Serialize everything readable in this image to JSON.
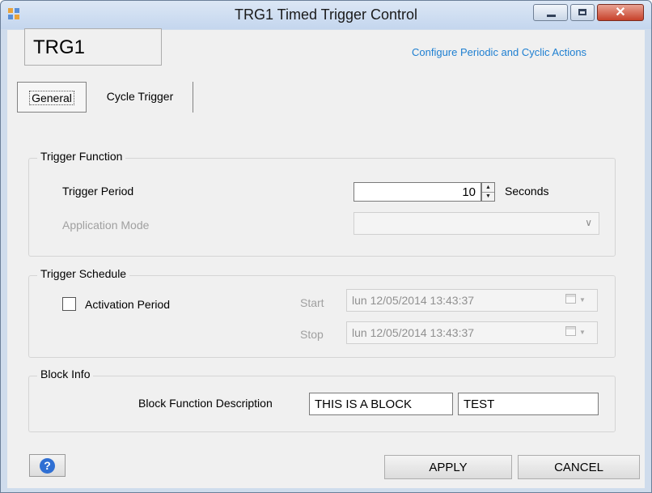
{
  "window": {
    "title": "TRG1 Timed Trigger Control",
    "close_glyph": "✕",
    "minimize_icon": "minimize-icon",
    "maximize_icon": "maximize-icon"
  },
  "header": {
    "block_name": "TRG1",
    "link_text": "Configure Periodic and Cyclic Actions",
    "link_color": "#1e7fd1"
  },
  "tabs": [
    {
      "label": "General",
      "selected": true
    },
    {
      "label": "Cycle Trigger",
      "selected": false
    }
  ],
  "trigger_function": {
    "title": "Trigger Function",
    "trigger_period_label": "Trigger Period",
    "trigger_period_value": "10",
    "trigger_period_unit": "Seconds",
    "application_mode_label": "Application Mode",
    "application_mode_value": ""
  },
  "trigger_schedule": {
    "title": "Trigger Schedule",
    "activation_label": "Activation Period",
    "activation_checked": false,
    "start_label": "Start",
    "start_value": "lun  12/05/2014 13:43:37",
    "stop_label": "Stop",
    "stop_value": "lun  12/05/2014 13:43:37"
  },
  "block_info": {
    "title": "Block Info",
    "description_label": "Block Function Description",
    "description_value": "THIS IS A BLOCK",
    "extra_value": "TEST"
  },
  "footer": {
    "help_glyph": "?",
    "apply_label": "APPLY",
    "cancel_label": "CANCEL"
  },
  "colors": {
    "title_bar": "#c4d6ee",
    "close_button": "#c7412a",
    "dialog_bg": "#f0f0f0",
    "help_icon": "#2f6fd3"
  }
}
